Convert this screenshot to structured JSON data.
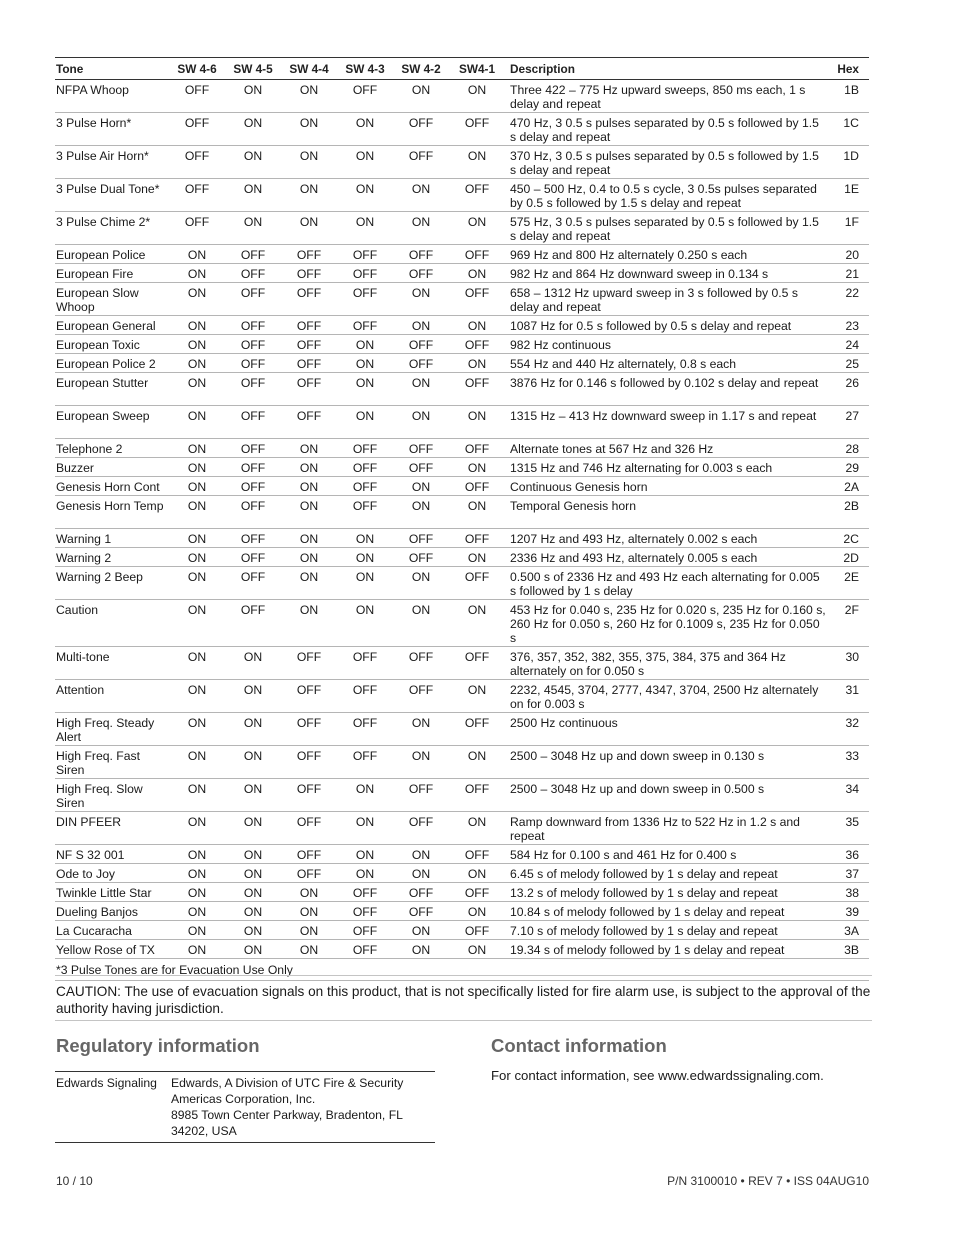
{
  "tone_table": {
    "headers": {
      "tone": "Tone",
      "sw46": "SW 4-6",
      "sw45": "SW 4-5",
      "sw44": "SW 4-4",
      "sw43": "SW 4-3",
      "sw42": "SW 4-2",
      "sw41": "SW4-1",
      "description": "Description",
      "hex": "Hex"
    },
    "rows": [
      {
        "tone": "NFPA Whoop",
        "sw": [
          "OFF",
          "ON",
          "ON",
          "OFF",
          "ON",
          "ON"
        ],
        "description": "Three 422 – 775 Hz upward sweeps, 850 ms each, 1 s delay and repeat",
        "hex": "1B",
        "lines": 2
      },
      {
        "tone": "3 Pulse Horn*",
        "sw": [
          "OFF",
          "ON",
          "ON",
          "ON",
          "OFF",
          "OFF"
        ],
        "description": "470 Hz, 3 0.5 s pulses separated by 0.5 s followed by 1.5 s delay and repeat",
        "hex": "1C",
        "lines": 2
      },
      {
        "tone": "3 Pulse Air Horn*",
        "sw": [
          "OFF",
          "ON",
          "ON",
          "ON",
          "OFF",
          "ON"
        ],
        "description": "370 Hz, 3 0.5 s pulses separated by 0.5 s followed by 1.5 s delay and repeat",
        "hex": "1D",
        "lines": 2
      },
      {
        "tone": "3 Pulse Dual Tone*",
        "sw": [
          "OFF",
          "ON",
          "ON",
          "ON",
          "ON",
          "OFF"
        ],
        "description": "450 – 500 Hz, 0.4 to 0.5 s cycle, 3 0.5s pulses separated by 0.5 s followed by 1.5 s delay and repeat",
        "hex": "1E",
        "lines": 2
      },
      {
        "tone": "3 Pulse Chime 2*",
        "sw": [
          "OFF",
          "ON",
          "ON",
          "ON",
          "ON",
          "ON"
        ],
        "description": "575 Hz, 3 0.5 s pulses separated by 0.5 s followed by 1.5 s delay and repeat",
        "hex": "1F",
        "lines": 2
      },
      {
        "tone": "European Police",
        "sw": [
          "ON",
          "OFF",
          "OFF",
          "OFF",
          "OFF",
          "OFF"
        ],
        "description": "969 Hz and 800 Hz alternately 0.250 s each",
        "hex": "20",
        "lines": 1
      },
      {
        "tone": "European Fire",
        "sw": [
          "ON",
          "OFF",
          "OFF",
          "OFF",
          "OFF",
          "ON"
        ],
        "description": "982 Hz and 864 Hz downward sweep in 0.134 s",
        "hex": "21",
        "lines": 1
      },
      {
        "tone": "European Slow Whoop",
        "sw": [
          "ON",
          "OFF",
          "OFF",
          "OFF",
          "ON",
          "OFF"
        ],
        "description": "658 – 1312 Hz upward sweep in 3 s followed by 0.5 s delay and repeat",
        "hex": "22",
        "lines": 2
      },
      {
        "tone": "European General",
        "sw": [
          "ON",
          "OFF",
          "OFF",
          "OFF",
          "ON",
          "ON"
        ],
        "description": "1087 Hz for 0.5 s followed by 0.5 s delay and repeat",
        "hex": "23",
        "lines": 1
      },
      {
        "tone": "European Toxic",
        "sw": [
          "ON",
          "OFF",
          "OFF",
          "ON",
          "OFF",
          "OFF"
        ],
        "description": "982 Hz continuous",
        "hex": "24",
        "lines": 1
      },
      {
        "tone": "European Police 2",
        "sw": [
          "ON",
          "OFF",
          "OFF",
          "ON",
          "OFF",
          "ON"
        ],
        "description": "554 Hz and 440 Hz alternately, 0.8 s each",
        "hex": "25",
        "lines": 1
      },
      {
        "tone": "European Stutter",
        "sw": [
          "ON",
          "OFF",
          "OFF",
          "ON",
          "ON",
          "OFF"
        ],
        "description": "3876 Hz for 0.146 s followed by 0.102 s delay and repeat",
        "hex": "26",
        "lines": 2
      },
      {
        "tone": "European Sweep",
        "sw": [
          "ON",
          "OFF",
          "OFF",
          "ON",
          "ON",
          "ON"
        ],
        "description": "1315 Hz – 413 Hz downward sweep in 1.17 s and repeat",
        "hex": "27",
        "lines": 2
      },
      {
        "tone": "Telephone 2",
        "sw": [
          "ON",
          "OFF",
          "ON",
          "OFF",
          "OFF",
          "OFF"
        ],
        "description": "Alternate tones at 567 Hz and 326 Hz",
        "hex": "28",
        "lines": 1
      },
      {
        "tone": "Buzzer",
        "sw": [
          "ON",
          "OFF",
          "ON",
          "OFF",
          "OFF",
          "ON"
        ],
        "description": "1315 Hz and 746 Hz alternating for 0.003 s each",
        "hex": "29",
        "lines": 1
      },
      {
        "tone": "Genesis Horn Cont",
        "sw": [
          "ON",
          "OFF",
          "ON",
          "OFF",
          "ON",
          "OFF"
        ],
        "description": "Continuous Genesis horn",
        "hex": "2A",
        "lines": 1
      },
      {
        "tone": "Genesis Horn Temp",
        "sw": [
          "ON",
          "OFF",
          "ON",
          "OFF",
          "ON",
          "ON"
        ],
        "description": "Temporal Genesis horn",
        "hex": "2B",
        "lines": 2
      },
      {
        "tone": "Warning 1",
        "sw": [
          "ON",
          "OFF",
          "ON",
          "ON",
          "OFF",
          "OFF"
        ],
        "description": "1207 Hz and 493 Hz, alternately 0.002 s each",
        "hex": "2C",
        "lines": 1
      },
      {
        "tone": "Warning 2",
        "sw": [
          "ON",
          "OFF",
          "ON",
          "ON",
          "OFF",
          "ON"
        ],
        "description": "2336 Hz and 493 Hz, alternately 0.005 s each",
        "hex": "2D",
        "lines": 1
      },
      {
        "tone": "Warning 2 Beep",
        "sw": [
          "ON",
          "OFF",
          "ON",
          "ON",
          "ON",
          "OFF"
        ],
        "description": "0.500 s of 2336 Hz and 493 Hz each alternating for 0.005 s followed by 1 s delay",
        "hex": "2E",
        "lines": 2
      },
      {
        "tone": "Caution",
        "sw": [
          "ON",
          "OFF",
          "ON",
          "ON",
          "ON",
          "ON"
        ],
        "description": "453 Hz for 0.040 s, 235 Hz for 0.020 s, 235 Hz for 0.160 s, 260 Hz for 0.050 s, 260 Hz for 0.1009 s, 235 Hz for 0.050 s",
        "hex": "2F",
        "lines": 3
      },
      {
        "tone": "Multi-tone",
        "sw": [
          "ON",
          "ON",
          "OFF",
          "OFF",
          "OFF",
          "OFF"
        ],
        "description": "376, 357, 352, 382, 355, 375, 384, 375 and 364 Hz alternately on for 0.050 s",
        "hex": "30",
        "lines": 2
      },
      {
        "tone": "Attention",
        "sw": [
          "ON",
          "ON",
          "OFF",
          "OFF",
          "OFF",
          "ON"
        ],
        "description": "2232, 4545, 3704, 2777, 4347, 3704, 2500 Hz alternately on for 0.003 s",
        "hex": "31",
        "lines": 2
      },
      {
        "tone": "High Freq. Steady Alert",
        "sw": [
          "ON",
          "ON",
          "OFF",
          "OFF",
          "ON",
          "OFF"
        ],
        "description": "2500 Hz continuous",
        "hex": "32",
        "lines": 2
      },
      {
        "tone": "High Freq. Fast Siren",
        "sw": [
          "ON",
          "ON",
          "OFF",
          "OFF",
          "ON",
          "ON"
        ],
        "description": "2500 – 3048 Hz up and down sweep in 0.130 s",
        "hex": "33",
        "lines": 2
      },
      {
        "tone": "High Freq. Slow Siren",
        "sw": [
          "ON",
          "ON",
          "OFF",
          "ON",
          "OFF",
          "OFF"
        ],
        "description": "2500 – 3048 Hz up and down sweep in 0.500 s",
        "hex": "34",
        "lines": 2
      },
      {
        "tone": "DIN PFEER",
        "sw": [
          "ON",
          "ON",
          "OFF",
          "ON",
          "OFF",
          "ON"
        ],
        "description": "Ramp downward from 1336 Hz to 522 Hz in 1.2 s and repeat",
        "hex": "35",
        "lines": 2
      },
      {
        "tone": "NF S 32 001",
        "sw": [
          "ON",
          "ON",
          "OFF",
          "ON",
          "ON",
          "OFF"
        ],
        "description": "584 Hz for 0.100 s and 461 Hz for 0.400 s",
        "hex": "36",
        "lines": 1
      },
      {
        "tone": "Ode to Joy",
        "sw": [
          "ON",
          "ON",
          "OFF",
          "ON",
          "ON",
          "ON"
        ],
        "description": "6.45 s of melody followed by 1 s delay and repeat",
        "hex": "37",
        "lines": 1
      },
      {
        "tone": "Twinkle Little Star",
        "sw": [
          "ON",
          "ON",
          "ON",
          "OFF",
          "OFF",
          "OFF"
        ],
        "description": "13.2 s of melody followed by 1 s delay and repeat",
        "hex": "38",
        "lines": 1
      },
      {
        "tone": "Dueling Banjos",
        "sw": [
          "ON",
          "ON",
          "ON",
          "OFF",
          "OFF",
          "ON"
        ],
        "description": "10.84 s of melody followed by 1 s delay and repeat",
        "hex": "39",
        "lines": 1
      },
      {
        "tone": "La Cucaracha",
        "sw": [
          "ON",
          "ON",
          "ON",
          "OFF",
          "ON",
          "OFF"
        ],
        "description": "7.10 s of melody followed by 1 s delay and repeat",
        "hex": "3A",
        "lines": 1
      },
      {
        "tone": "Yellow Rose of TX",
        "sw": [
          "ON",
          "ON",
          "ON",
          "OFF",
          "ON",
          "ON"
        ],
        "description": "19.34 s of melody followed by 1 s delay and repeat",
        "hex": "3B",
        "lines": 1
      }
    ],
    "footnote": "*3 Pulse Tones are for Evacuation Use Only"
  },
  "caution": "CAUTION:  The use of evacuation signals on this product, that is not specifically listed for fire alarm use, is subject to the approval of the authority having jurisdiction.",
  "regulatory": {
    "title": "Regulatory information",
    "label": "Edwards Signaling",
    "value_lines": [
      "Edwards, A Division of UTC Fire & Security",
      "Americas Corporation, Inc.",
      "8985 Town Center Parkway, Bradenton, FL",
      "34202, USA"
    ]
  },
  "contact": {
    "title": "Contact information",
    "text": "For contact information, see www.edwardssignaling.com."
  },
  "footer": {
    "page": "10 / 10",
    "part_number": "P/N 3100010 • REV 7 • ISS 04AUG10"
  }
}
